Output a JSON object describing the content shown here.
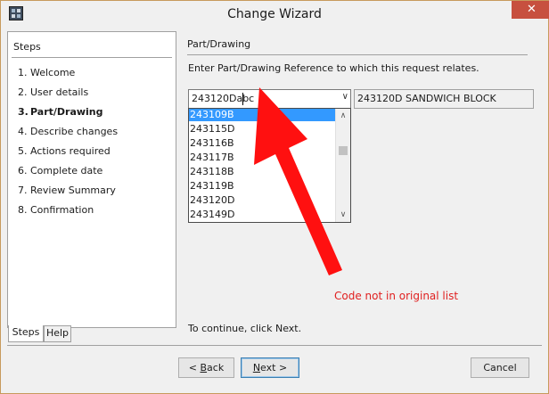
{
  "window": {
    "title": "Change Wizard",
    "close_symbol": "✕"
  },
  "steps_panel": {
    "title": "Steps",
    "items": [
      {
        "num": "1.",
        "label": "Welcome"
      },
      {
        "num": "2.",
        "label": "User details"
      },
      {
        "num": "3.",
        "label": "Part/Drawing",
        "active": true
      },
      {
        "num": "4.",
        "label": "Describe changes"
      },
      {
        "num": "5.",
        "label": "Actions required"
      },
      {
        "num": "6.",
        "label": "Complete date"
      },
      {
        "num": "7.",
        "label": "Review Summary"
      },
      {
        "num": "8.",
        "label": "Confirmation"
      }
    ],
    "tabs": [
      "Steps",
      "Help"
    ]
  },
  "content": {
    "section_title": "Part/Drawing",
    "instruction": "Enter Part/Drawing Reference to which this request relates.",
    "combo_value": "243120Dabc",
    "description_value": "243120D SANDWICH BLOCK",
    "dropdown_options": [
      "243109B",
      "243115D",
      "243116B",
      "243117B",
      "243118B",
      "243119B",
      "243120D",
      "243149D"
    ],
    "selected_option": "243109B",
    "annotation": "Code not in original list",
    "annotation_color": "#e02020",
    "continue_text": "To continue, click Next."
  },
  "buttons": {
    "back_prefix": "< ",
    "back_key": "B",
    "back_rest": "ack",
    "next_key": "N",
    "next_rest": "ext >",
    "cancel": "Cancel"
  },
  "icons": {
    "app": "wizard-app-icon",
    "dropdown": "chevron-down-icon",
    "scroll_up": "scroll-up-icon",
    "scroll_down": "scroll-down-icon"
  },
  "colors": {
    "selection": "#3399ff",
    "close_button": "#c7503f",
    "arrow": "#ff1010"
  }
}
